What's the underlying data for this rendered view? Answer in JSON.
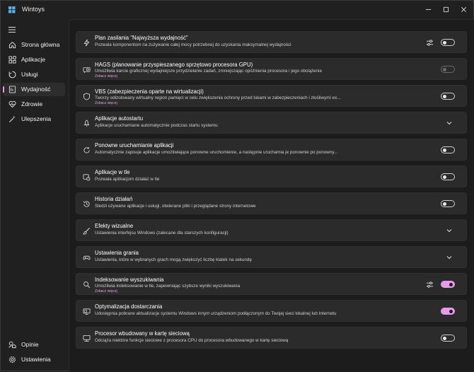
{
  "app": {
    "title": "Wintoys"
  },
  "sidebar": {
    "items": [
      {
        "label": "Strona główna",
        "icon": "home-icon"
      },
      {
        "label": "Aplikacje",
        "icon": "apps-icon"
      },
      {
        "label": "Usługi",
        "icon": "services-icon"
      },
      {
        "label": "Wydajność",
        "icon": "performance-icon",
        "active": true
      },
      {
        "label": "Zdrowie",
        "icon": "health-icon"
      },
      {
        "label": "Ulepszenia",
        "icon": "tweaks-icon"
      }
    ],
    "footer": [
      {
        "label": "Opinie",
        "icon": "feedback-icon"
      },
      {
        "label": "Ustawienia",
        "icon": "gear-icon"
      }
    ]
  },
  "cards": [
    {
      "title": "Plan zasilania \"Najwyższa wydajność\"",
      "desc": "Pozwala komponentom na zużywanie całej mocy potrzebnej do uzyskania maksymalnej wydajności",
      "link": "",
      "control": "toggle",
      "state": "off",
      "settings": true
    },
    {
      "title": "HAGS (planowanie przyspieszanego sprzętowo procesora GPU)",
      "desc": "Umożliwia karcie graficznej wydajniejsze przydzielanie zadań, zmniejszając opóźnienia procesora i jego obciążenie",
      "link": "Zobacz więcej",
      "control": "toggle",
      "state": "disabled",
      "settings": false
    },
    {
      "title": "VBS (zabezpieczenia oparte na wirtualizacji)",
      "desc": "Tworzy odizolowany wirtualny region pamięci w celu zwiększenia ochrony przed lukami w zabezpieczeniach i złośliwymi ex...",
      "link": "Zobacz więcej",
      "control": "toggle",
      "state": "off",
      "settings": false
    },
    {
      "title": "Aplikacje autostartu",
      "desc": "Aplikacje uruchamiane automatycznie podczas startu systemu",
      "link": "",
      "control": "expander",
      "state": "",
      "settings": false
    },
    {
      "title": "Ponowne uruchamianie aplikacji",
      "desc": "Automatycznie zapisuje aplikacje umożliwiające ponowne uruchomienie, a następnie uruchamia je ponownie po ponowny...",
      "link": "",
      "control": "toggle",
      "state": "off",
      "settings": false
    },
    {
      "title": "Aplikacje w tle",
      "desc": "Pozwala aplikacjom działać w tle",
      "link": "",
      "control": "toggle",
      "state": "off",
      "settings": false
    },
    {
      "title": "Historia działań",
      "desc": "Śledzi używane aplikacje i usługi, otwierane pliki i przeglądane strony internetowe",
      "link": "",
      "control": "toggle",
      "state": "off",
      "settings": false
    },
    {
      "title": "Efekty wizualne",
      "desc": "Ustawienia interfejsu Windows (zalecane dla starszych konfiguracji)",
      "link": "",
      "control": "expander",
      "state": "",
      "settings": false
    },
    {
      "title": "Ustawienia grania",
      "desc": "Ustawienia, które w wybranych grach mogą zwiększyć liczbę klatek na sekundę",
      "link": "",
      "control": "expander",
      "state": "",
      "settings": false
    },
    {
      "title": "Indeksowanie wyszukiwania",
      "desc": "Umożliwia indeksowanie w tle, zapewniając szybsze wyniki wyszukiwania",
      "link": "Zobacz więcej",
      "control": "toggle",
      "state": "on",
      "settings": true
    },
    {
      "title": "Optymalizacja dostarczania",
      "desc": "Udostępnia pobrane aktualizacje systemu Windows innym urządzeniom podłączonym do Twojej sieci lokalnej lub Internetu",
      "link": "",
      "control": "toggle",
      "state": "on",
      "settings": false
    },
    {
      "title": "Procesor wbudowany w kartę sieciową",
      "desc": "Odciąża niektóre funkcje sieciowe z procesora CPU do procesora wbudowanego w kartę sieciową",
      "link": "",
      "control": "toggle",
      "state": "off",
      "settings": false
    }
  ],
  "colors": {
    "accent": "#e79be8",
    "background": "#1c1c1c",
    "card": "#2b2b2b"
  }
}
